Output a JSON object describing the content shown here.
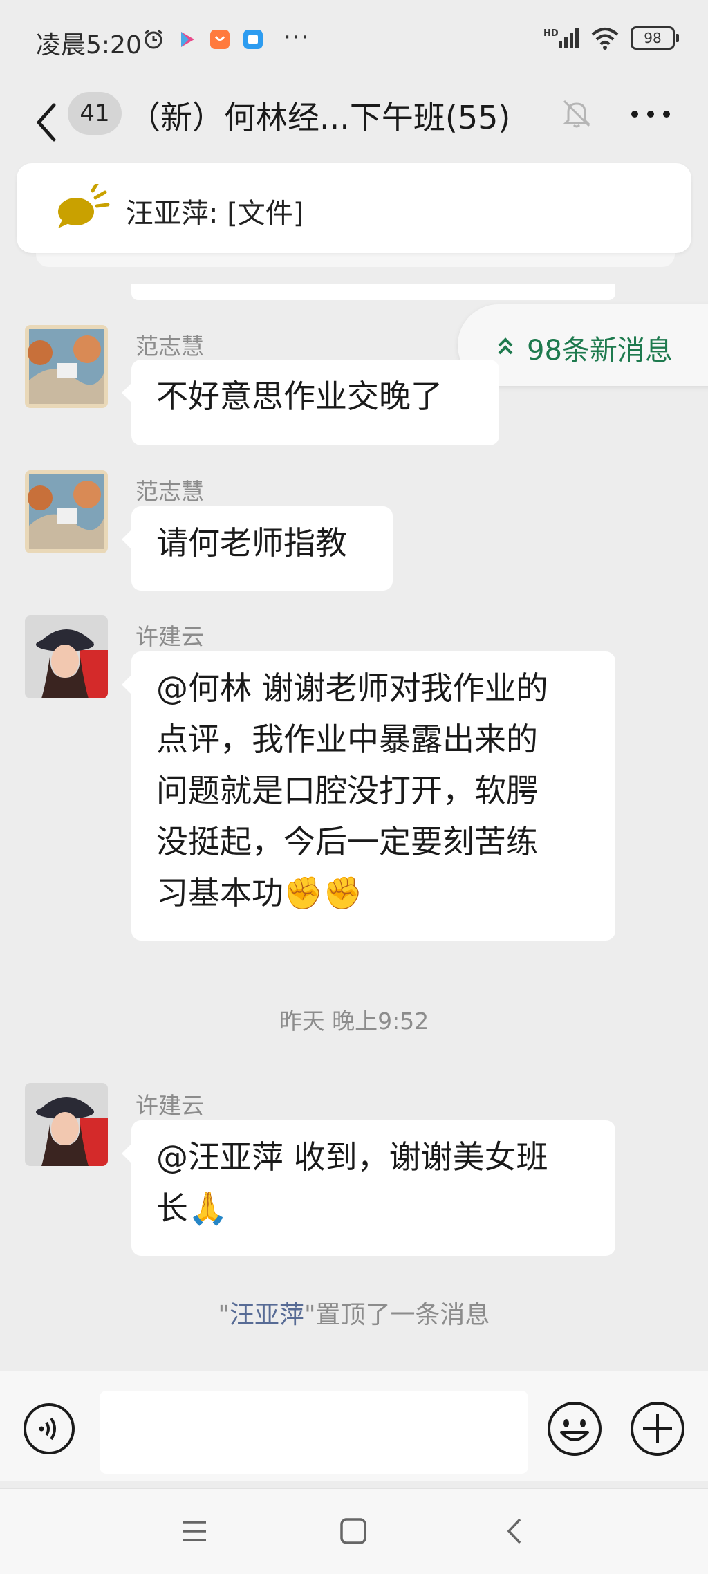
{
  "status_bar": {
    "time": "凌晨5:20",
    "more": "···",
    "battery": "98",
    "signal_label": "HD"
  },
  "header": {
    "unread_count": "41",
    "title": "（新）何林经...下午班(55)"
  },
  "pinned": {
    "text": "汪亚萍: [文件]"
  },
  "new_messages": {
    "label": "98条新消息"
  },
  "messages": [
    {
      "sender": "范志慧",
      "text": "不好意思作业交晚了"
    },
    {
      "sender": "范志慧",
      "text": "请何老师指教"
    },
    {
      "sender": "许建云",
      "lines": [
        "@何林  谢谢老师对我作业的",
        "点评，我作业中暴露出来的",
        "问题就是口腔没打开，软腭",
        "没挺起，今后一定要刻苦练",
        "习基本功✊✊"
      ]
    },
    {
      "sender": "许建云",
      "lines": [
        "@汪亚萍  收到，谢谢美女班",
        "长🙏"
      ]
    }
  ],
  "timestamp": "昨天 晚上9:52",
  "system_note": {
    "prefix": "\"",
    "name": "汪亚萍",
    "suffix": "\"置顶了一条消息"
  },
  "colors": {
    "background": "#ededed",
    "bubble": "#ffffff",
    "new_messages_text": "#1e7a4e",
    "system_name": "#576b95"
  }
}
